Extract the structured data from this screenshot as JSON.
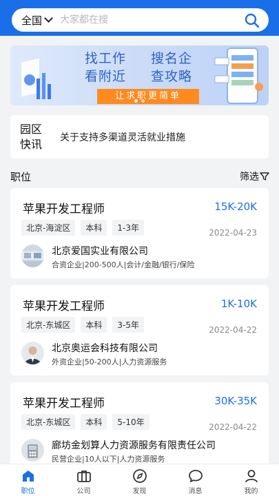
{
  "header": {
    "city": "全国",
    "search_placeholder": "大家都在搜"
  },
  "banner": {
    "line1_a": "找工作",
    "line1_b": "搜名企",
    "line2_a": "看附近",
    "line2_b": "查攻略",
    "cta": "让求职更简单"
  },
  "news": {
    "tag": "园区快讯",
    "text": "关于支持多渠道灵活就业措施"
  },
  "section": {
    "title": "职位",
    "filter": "筛选"
  },
  "jobs": [
    {
      "title": "苹果开发工程师",
      "salary": "15K-20K",
      "location": "北京-海淀区",
      "education": "本科",
      "experience": "1-3年",
      "date": "2022-04-23",
      "company": "北京爱国实业有限公司",
      "meta": "合资企业|200-500人|会计/金融/银行/保险"
    },
    {
      "title": "苹果开发工程师",
      "salary": "1K-10K",
      "location": "北京-东城区",
      "education": "本科",
      "experience": "3-5年",
      "date": "2022-04-22",
      "company": "北京奥运会科技有限公司",
      "meta": "外资企业|50-200人|人力资源服务"
    },
    {
      "title": "苹果开发工程师",
      "salary": "30K-35K",
      "location": "北京-东城区",
      "education": "本科",
      "experience": "5-10年",
      "date": "2022-04-22",
      "company": "廊坊金划算人力资源服务有限责任公司",
      "meta": "民营企业|10人以下|人力资源服务"
    }
  ],
  "tabs": [
    {
      "label": "职位",
      "icon": "home-icon",
      "active": true
    },
    {
      "label": "公司",
      "icon": "briefcase-icon",
      "active": false
    },
    {
      "label": "发现",
      "icon": "compass-icon",
      "active": false
    },
    {
      "label": "消息",
      "icon": "chat-bubble-icon",
      "active": false
    },
    {
      "label": "我的",
      "icon": "user-icon",
      "active": false
    }
  ],
  "colors": {
    "brand": "#1a6fe8",
    "cta": "#ff8a1e",
    "page_bg": "#f2f3f5"
  }
}
